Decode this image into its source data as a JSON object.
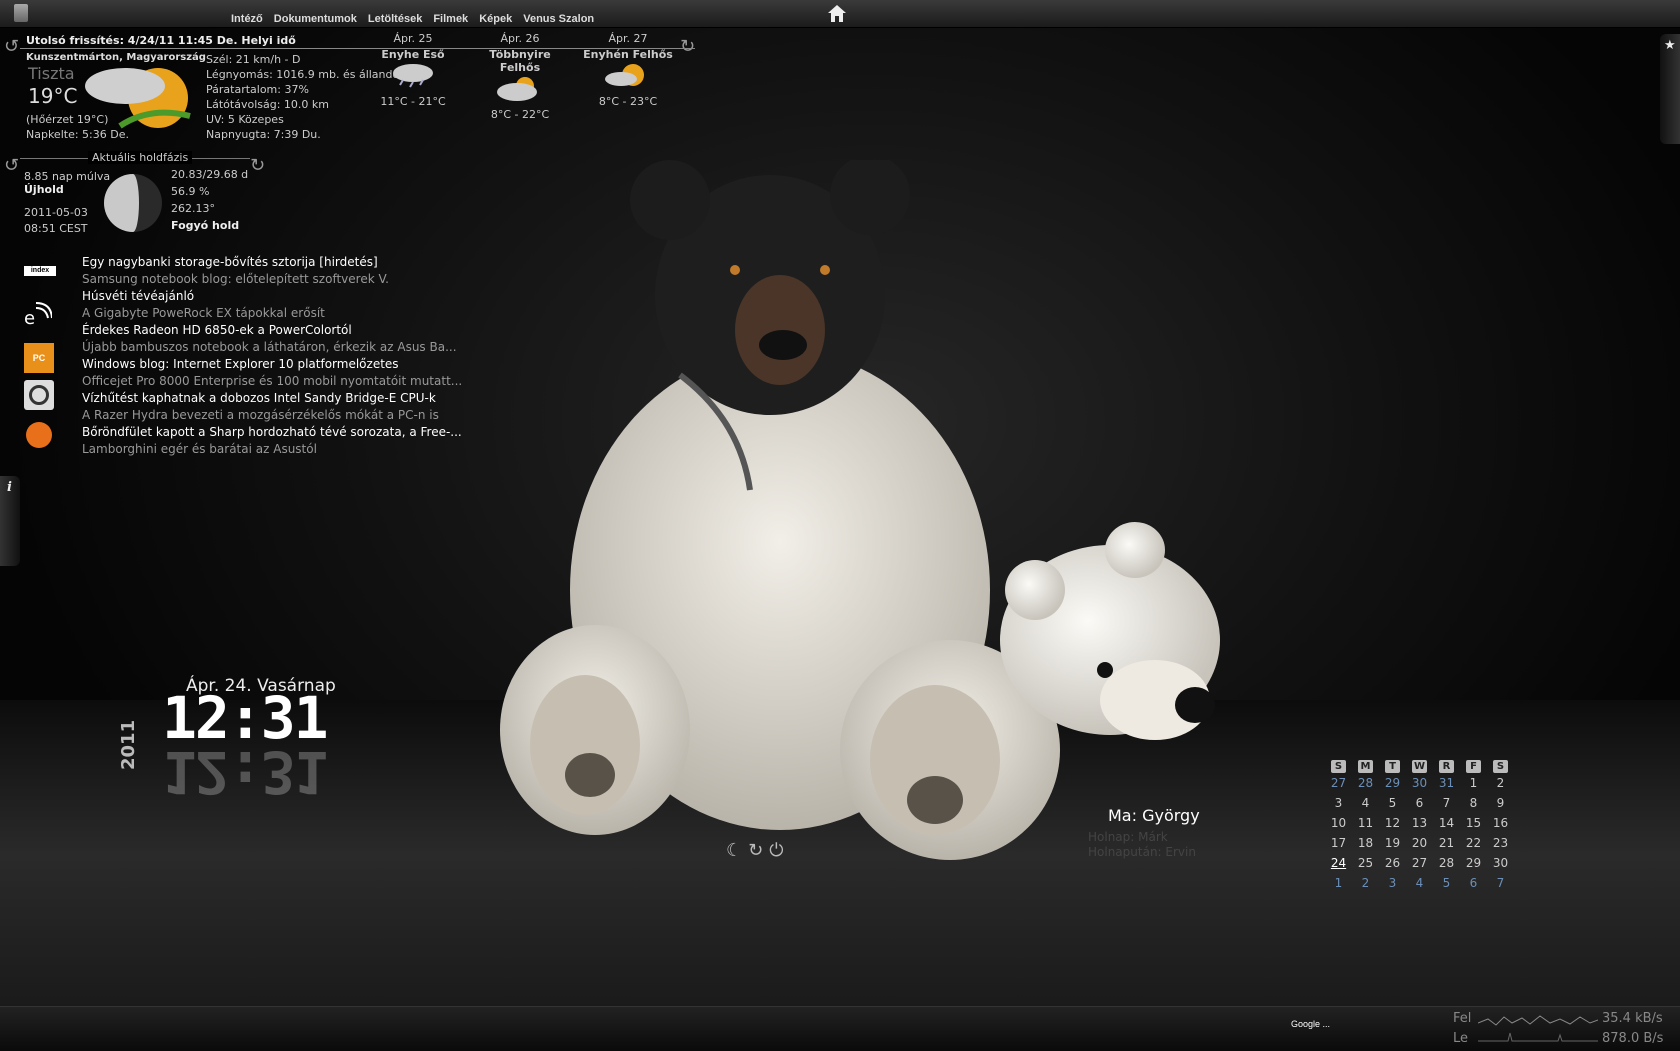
{
  "colors": {
    "accent_blue": "#6b8fb8",
    "text": "#dddddd",
    "dim": "#aaaaaa"
  },
  "topbar": {
    "nav": [
      "Intéző",
      "Dokumentumok",
      "Letöltések",
      "Filmek",
      "Képek",
      "Venus Szalon"
    ],
    "home_icon": "home-icon",
    "trash_icon": "trash-icon"
  },
  "weather": {
    "updated": "Utolsó frissítés: 4/24/11 11:45 De. Helyi idő",
    "location": "Kunszentmárton, Magyarország",
    "condition": "Tiszta",
    "temp": "19°C",
    "feels": "(Hőérzet 19°C)",
    "sunrise": "Napkelte: 5:36 De.",
    "details": [
      "Szél: 21 km/h - D",
      "Légnyomás: 1016.9 mb. és állandó",
      "Páratartalom: 37%",
      "Látótávolság: 10.0 km",
      "UV: 5 Közepes",
      "Napnyugta: 7:39 Du."
    ],
    "forecast": [
      {
        "date": "Ápr. 25",
        "cond": "Enyhe Eső",
        "range": "11°C - 21°C"
      },
      {
        "date": "Ápr. 26",
        "cond": "Többnyire Felhős",
        "range": "8°C - 22°C"
      },
      {
        "date": "Ápr. 27",
        "cond": "Enyhén Felhős",
        "range": "8°C - 23°C"
      }
    ]
  },
  "moon": {
    "title": "Aktuális holdfázis",
    "days": "8.85 nap múlva",
    "next": "Újhold",
    "date": "2011-05-03",
    "time": "08:51 CEST",
    "cycle": "20.83/29.68 d",
    "illum": "56.9 %",
    "angle": "262.13°",
    "phase": "Fogyó hold"
  },
  "news": [
    {
      "text": "Egy nagybanki storage-bővítés sztorija [hirdetés]",
      "bright": true
    },
    {
      "text": "Samsung notebook blog: előtelepített szoftverek V.",
      "bright": false
    },
    {
      "text": "Húsvéti tévéajánló",
      "bright": true
    },
    {
      "text": "A Gigabyte PoweRock EX tápokkal erősít",
      "bright": false
    },
    {
      "text": "Érdekes Radeon HD 6850-ek a PowerColortól",
      "bright": true
    },
    {
      "text": "Újabb bambuszos notebook a láthatáron, érkezik az Asus Ba...",
      "bright": false
    },
    {
      "text": "Windows blog: Internet Explorer 10 platformelőzetes",
      "bright": true
    },
    {
      "text": "Officejet Pro 8000 Enterprise és 100 mobil nyomtatóit mutatt...",
      "bright": false
    },
    {
      "text": "Vízhűtést kaphatnak a dobozos Intel Sandy Bridge-E CPU-k",
      "bright": true
    },
    {
      "text": "A Razer Hydra bevezeti a mozgásérzékelős mókát a PC-n is",
      "bright": false
    },
    {
      "text": "Bőröndfület kapott a Sharp hordozható tévé sorozata, a Free-...",
      "bright": true
    },
    {
      "text": "Lamborghini egér és barátai az Asustól",
      "bright": false
    }
  ],
  "news_logos": [
    "index",
    "e",
    "PC fórum",
    "prohardver",
    "mobilarena"
  ],
  "clock": {
    "date": "Ápr. 24. Vasárnap",
    "time": "12:31",
    "year": "2011"
  },
  "nameday": {
    "today": "Ma: György",
    "tomorrow": "Holnap: Márk",
    "after": "Holnapután: Ervin"
  },
  "calendar": {
    "headers": [
      "S",
      "M",
      "T",
      "W",
      "R",
      "F",
      "S"
    ],
    "weeks": [
      [
        "27",
        "28",
        "29",
        "30",
        "31",
        "1",
        "2"
      ],
      [
        "3",
        "4",
        "5",
        "6",
        "7",
        "8",
        "9"
      ],
      [
        "10",
        "11",
        "12",
        "13",
        "14",
        "15",
        "16"
      ],
      [
        "17",
        "18",
        "19",
        "20",
        "21",
        "22",
        "23"
      ],
      [
        "24",
        "25",
        "26",
        "27",
        "28",
        "29",
        "30"
      ],
      [
        "1",
        "2",
        "3",
        "4",
        "5",
        "6",
        "7"
      ]
    ],
    "today": "24"
  },
  "bottombar": {
    "google": "Google ...",
    "up_label": "Fel",
    "down_label": "Le",
    "up_rate": "35.4 kB/s",
    "down_rate": "878.0 B/s"
  }
}
